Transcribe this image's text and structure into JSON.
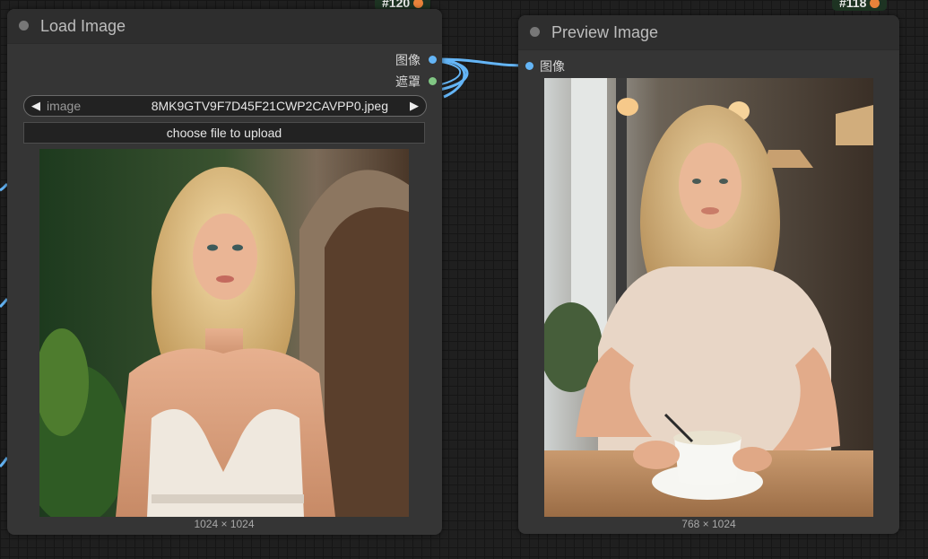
{
  "badges": {
    "left_id": "#120",
    "right_id": "#118"
  },
  "load_node": {
    "title": "Load Image",
    "outputs": [
      {
        "label": "图像",
        "color": "#64b5f6"
      },
      {
        "label": "遮罩",
        "color": "#81c784"
      }
    ],
    "combo": {
      "label": "image",
      "value": "8MK9GTV9F7D45F21CWP2CAVPP0.jpeg",
      "prev_icon": "◀",
      "next_icon": "▶"
    },
    "upload_label": "choose file to upload",
    "image_dims": "1024 × 1024",
    "image_alt": "Blonde woman in white lace dress by stone archway"
  },
  "preview_node": {
    "title": "Preview Image",
    "input": {
      "label": "图像",
      "color": "#64b5f6"
    },
    "image_dims": "768 × 1024",
    "image_alt": "Blonde woman in beige t-shirt holding coffee cup in cafe"
  },
  "colors": {
    "node_bg": "#353535",
    "header_bg": "#2e2e2e",
    "wire_blue": "#64b5f6",
    "badge_bg": "#1d3322"
  }
}
